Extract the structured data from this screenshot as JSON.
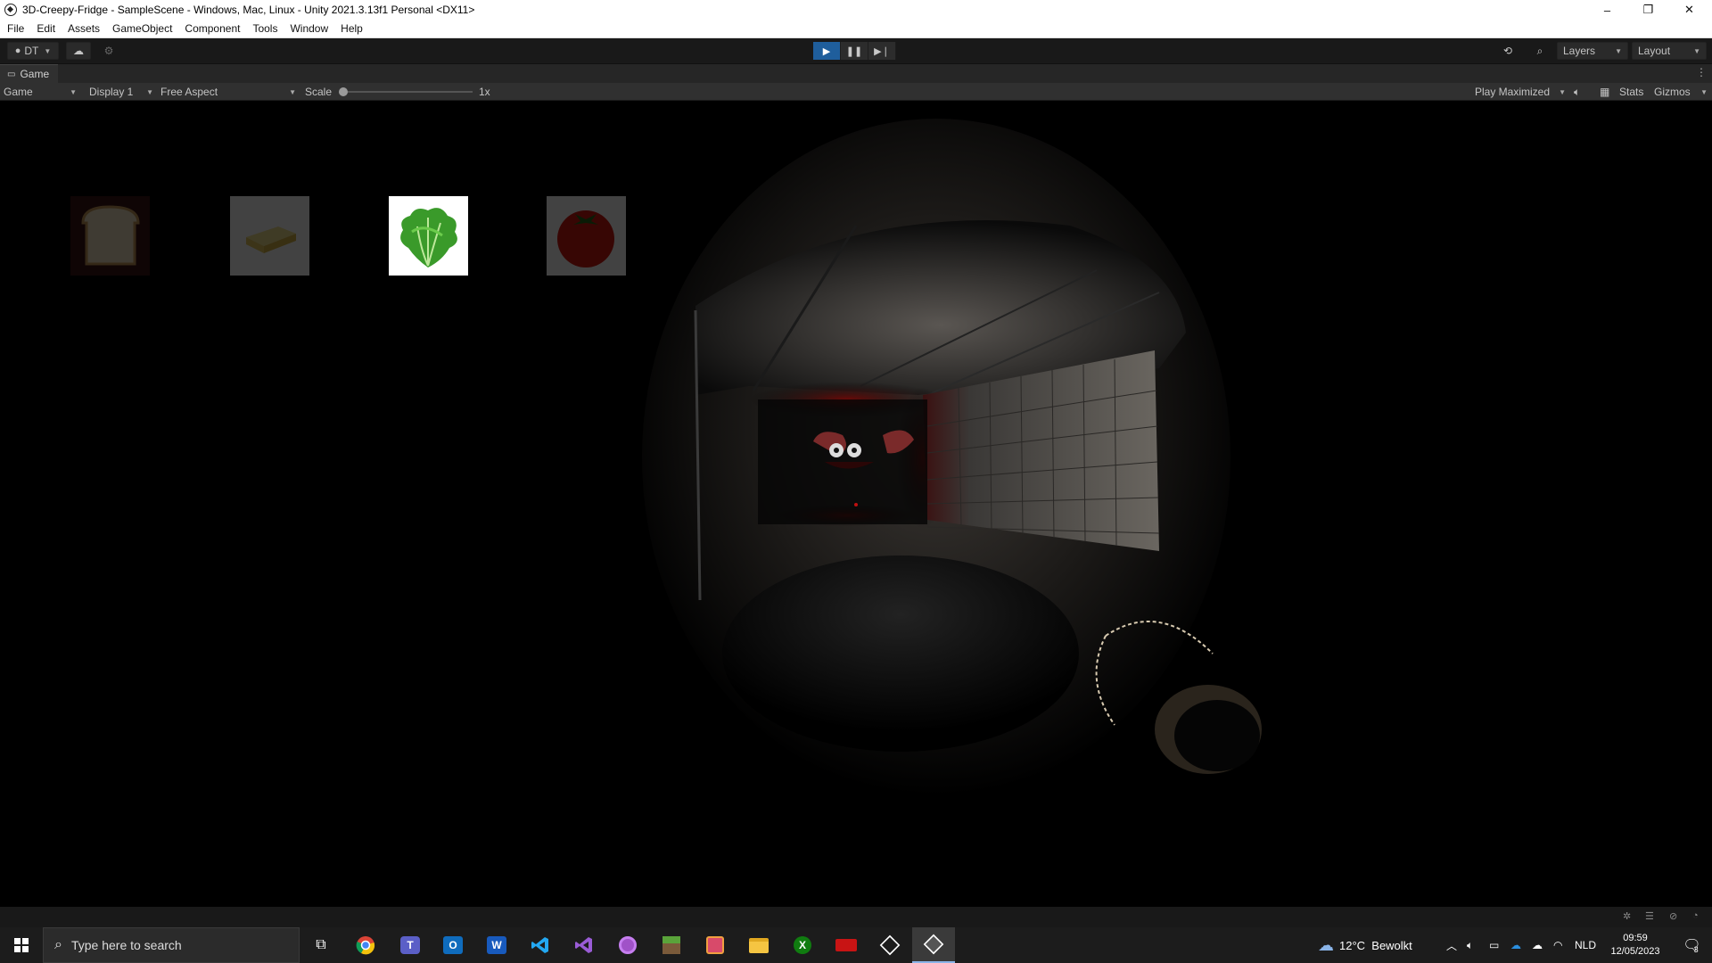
{
  "window": {
    "title": "3D-Creepy-Fridge - SampleScene - Windows, Mac, Linux - Unity 2021.3.13f1 Personal <DX11>",
    "controls": [
      "–",
      "❐",
      "✕"
    ]
  },
  "menu": [
    "File",
    "Edit",
    "Assets",
    "GameObject",
    "Component",
    "Tools",
    "Window",
    "Help"
  ],
  "toolbar": {
    "account_label": "DT",
    "layers_label": "Layers",
    "layout_label": "Layout",
    "play_state": "playing"
  },
  "game_tab": {
    "label": "Game",
    "mode_label": "Game",
    "display_label": "Display 1",
    "aspect_label": "Free Aspect",
    "scale_label": "Scale",
    "scale_value": "1x",
    "play_mode_label": "Play Maximized",
    "stats_label": "Stats",
    "gizmos_label": "Gizmos"
  },
  "inventory": {
    "slots": [
      {
        "item": "bread-icon",
        "active": false
      },
      {
        "item": "butter-icon",
        "active": false
      },
      {
        "item": "lettuce-icon",
        "active": true
      },
      {
        "item": "tomato-icon",
        "active": false
      }
    ]
  },
  "taskbar": {
    "search_placeholder": "Type here to search",
    "apps": [
      "task-view-icon",
      "chrome-icon",
      "teams-icon",
      "outlook-icon",
      "word-icon",
      "vscode-icon",
      "visual-studio-icon",
      "github-desktop-icon",
      "minecraft-icon",
      "app-icon",
      "file-explorer-icon",
      "xbox-icon",
      "red-app-icon",
      "unity-hub-icon",
      "unity-editor-icon"
    ],
    "weather": "12°C  Bewolkt",
    "language": "NLD",
    "time": "09:59",
    "date": "12/05/2023",
    "notification_count": "3"
  },
  "colors": {
    "play_active": "#1f5e9c",
    "taskbar_bg": "#1c1c1c",
    "editor_bg": "#191919"
  }
}
